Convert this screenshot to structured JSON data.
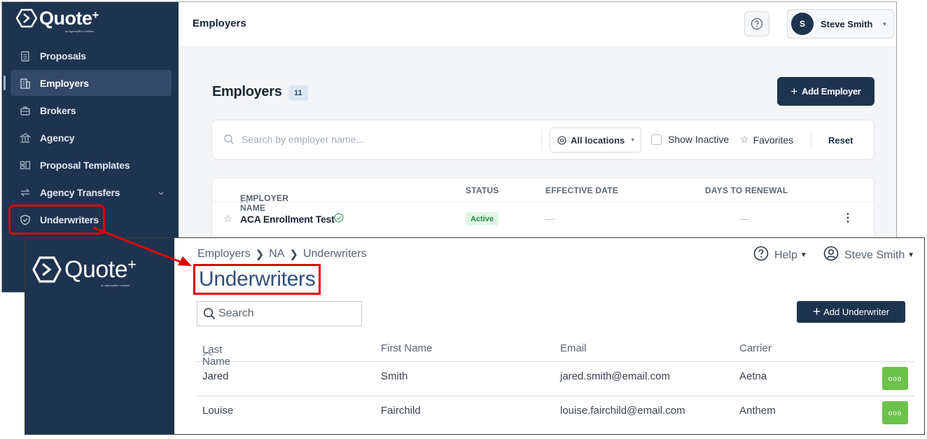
{
  "new_ui": {
    "logo": {
      "text": "Quote",
      "sup": "+",
      "tagline": "an AgencyBloc solution"
    },
    "sidebar": {
      "items": [
        {
          "label": "Proposals",
          "icon": "clipboard-icon"
        },
        {
          "label": "Employers",
          "icon": "building-icon",
          "active": true
        },
        {
          "label": "Brokers",
          "icon": "briefcase-icon"
        },
        {
          "label": "Agency",
          "icon": "bank-icon"
        },
        {
          "label": "Proposal Templates",
          "icon": "templates-icon"
        },
        {
          "label": "Agency Transfers",
          "icon": "transfer-icon"
        },
        {
          "label": "Underwriters",
          "icon": "shield-icon",
          "highlighted": true
        }
      ]
    },
    "topbar": {
      "title": "Employers",
      "user_initial": "S",
      "user_name": "Steve Smith"
    },
    "main": {
      "title": "Employers",
      "count": "11",
      "add_button": "Add Employer",
      "search_placeholder": "Search by employer name...",
      "location_filter": "All locations",
      "show_inactive": "Show Inactive",
      "favorites": "Favorites",
      "reset": "Reset",
      "columns": [
        "EMPLOYER NAME",
        "STATUS",
        "EFFECTIVE DATE",
        "DAYS TO RENEWAL"
      ],
      "rows": [
        {
          "name": "ACA Enrollment Test",
          "status": "Active",
          "effective_date": "—",
          "days_to_renewal": "—"
        }
      ]
    }
  },
  "old_ui": {
    "logo": {
      "text": "Quote",
      "sup": "+",
      "tagline": "an AgencyBloc solution"
    },
    "breadcrumb": [
      "Employers",
      "NA",
      "Underwriters"
    ],
    "title": "Underwriters",
    "help": "Help",
    "user_name": "Steve Smith",
    "search_placeholder": "Search",
    "add_button": "Add Underwriter",
    "columns": [
      "Last Name",
      "First Name",
      "Email",
      "Carrier"
    ],
    "rows": [
      {
        "last_name": "Jared",
        "first_name": "Smith",
        "email": "jared.smith@email.com",
        "carrier": "Aetna"
      },
      {
        "last_name": "Louise",
        "first_name": "Fairchild",
        "email": "louise.fairchild@email.com",
        "carrier": "Anthem"
      }
    ]
  },
  "colors": {
    "sidebar_bg": "#1e3350",
    "highlight_red": "#e00000",
    "action_green": "#6cc24a",
    "title_blue": "#2f4f78"
  }
}
